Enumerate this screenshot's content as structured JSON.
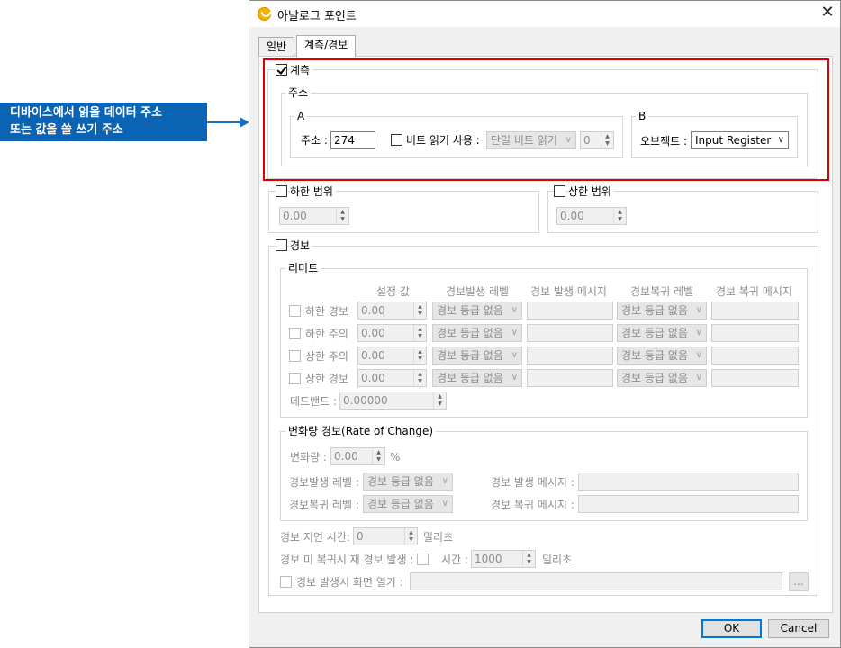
{
  "callout": {
    "line1": "디바이스에서 읽을 데이터 주소",
    "line2": "또는 값을 쓸 쓰기 주소"
  },
  "window": {
    "title": "아날로그 포인트",
    "close_glyph": "✕"
  },
  "tabs": [
    {
      "label": "일반"
    },
    {
      "label": "계측/경보"
    }
  ],
  "measure": {
    "checkbox_label": "계측",
    "checked": true,
    "address_group": "주소",
    "a_group": "A",
    "addr_label": "주소 :",
    "addr_value": "274",
    "bit_read_label": "비트 읽기 사용 :",
    "bit_read_mode": "단일 비트 읽기",
    "bit_index": "0",
    "b_group": "B",
    "object_label": "오브젝트 :",
    "object_value": "Input Register"
  },
  "range": {
    "low_label": "하한 범위",
    "low_value": "0.00",
    "high_label": "상한 범위",
    "high_value": "0.00"
  },
  "alarm": {
    "checkbox_label": "경보",
    "limit_group": "리미트",
    "columns": [
      "설정 값",
      "경보발생 레벨",
      "경보 발생 메시지",
      "경보복귀 레벨",
      "경보 복귀 메시지"
    ],
    "rows": [
      {
        "label": "하한 경보",
        "value": "0.00",
        "level": "경보 등급 없음",
        "restore_level": "경보 등급 없음"
      },
      {
        "label": "하한 주의",
        "value": "0.00",
        "level": "경보 등급 없음",
        "restore_level": "경보 등급 없음"
      },
      {
        "label": "상한 주의",
        "value": "0.00",
        "level": "경보 등급 없음",
        "restore_level": "경보 등급 없음"
      },
      {
        "label": "상한 경보",
        "value": "0.00",
        "level": "경보 등급 없음",
        "restore_level": "경보 등급 없음"
      }
    ],
    "deadband_label": "데드밴드 :",
    "deadband_value": "0.00000",
    "roc_group": "변화량 경보(Rate of Change)",
    "roc_label": "변화량 :",
    "roc_value": "0.00",
    "roc_unit": "%",
    "roc_level_label": "경보발생 레벨 :",
    "roc_level": "경보 등급 없음",
    "roc_msg_label": "경보 발생 메시지 :",
    "roc_restore_label": "경보복귀 레벨 :",
    "roc_restore_level": "경보 등급 없음",
    "roc_restore_msg_label": "경보 복귀 메시지 :",
    "delay_label": "경보 지연 시간:",
    "delay_value": "0",
    "delay_unit": "밀리초",
    "repeat_label": "경보 미 복귀시 재 경보 발생 :",
    "repeat_time_label": "시간 :",
    "repeat_time_value": "1000",
    "repeat_unit": "밀리초",
    "screen_label": "경보 발생시 화면 열기 :",
    "browse": "..."
  },
  "buttons": {
    "ok": "OK",
    "cancel": "Cancel"
  }
}
